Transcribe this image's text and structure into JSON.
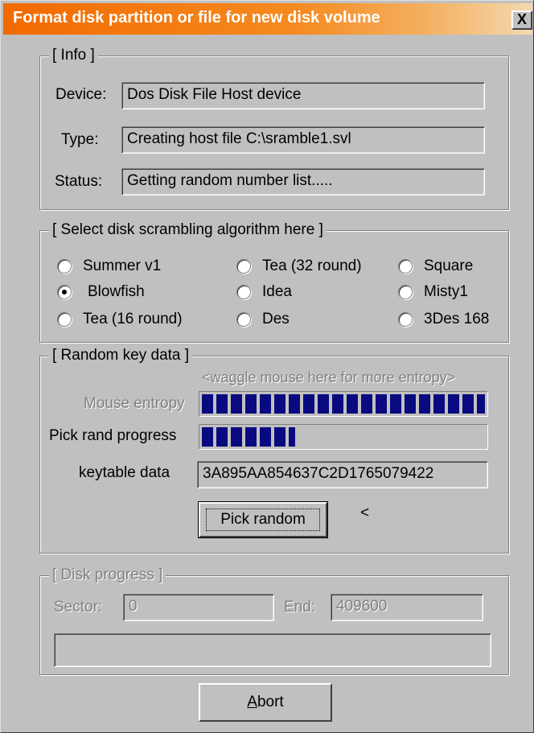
{
  "window": {
    "title": "Format disk partition or file for new disk volume",
    "close_glyph": "X"
  },
  "info": {
    "legend": "[ Info ]",
    "device_label": "Device:",
    "device_value": "Dos Disk File Host device",
    "type_label": "Type:",
    "type_value": "Creating host file C:\\sramble1.svl",
    "status_label": "Status:",
    "status_value": "Getting random number list....."
  },
  "algorithm": {
    "legend": "[ Select disk scrambling algorithm here ]",
    "options": [
      "Summer v1",
      "Blowfish",
      "Tea (16 round)",
      "Tea (32 round)",
      "Idea",
      "Des",
      "Square",
      "Misty1",
      "3Des 168"
    ],
    "selected": "Blowfish"
  },
  "random": {
    "legend": "[ Random key data ]",
    "hint": "<waggle mouse here for more entropy>",
    "mouse_entropy_label": "Mouse entropy",
    "mouse_entropy_progress": 1.0,
    "pick_rand_label": "Pick rand progress",
    "pick_rand_progress": 0.33,
    "keytable_label": "keytable data",
    "keytable_value": "3A895AA854637C2D1765079422",
    "pick_button": "Pick random",
    "arrow": "<"
  },
  "disk_progress": {
    "legend": "[ Disk progress ]",
    "sector_label": "Sector:",
    "sector_value": "0",
    "end_label": "End:",
    "end_value": "409600"
  },
  "abort_button": {
    "accel": "A",
    "rest": "bort"
  }
}
